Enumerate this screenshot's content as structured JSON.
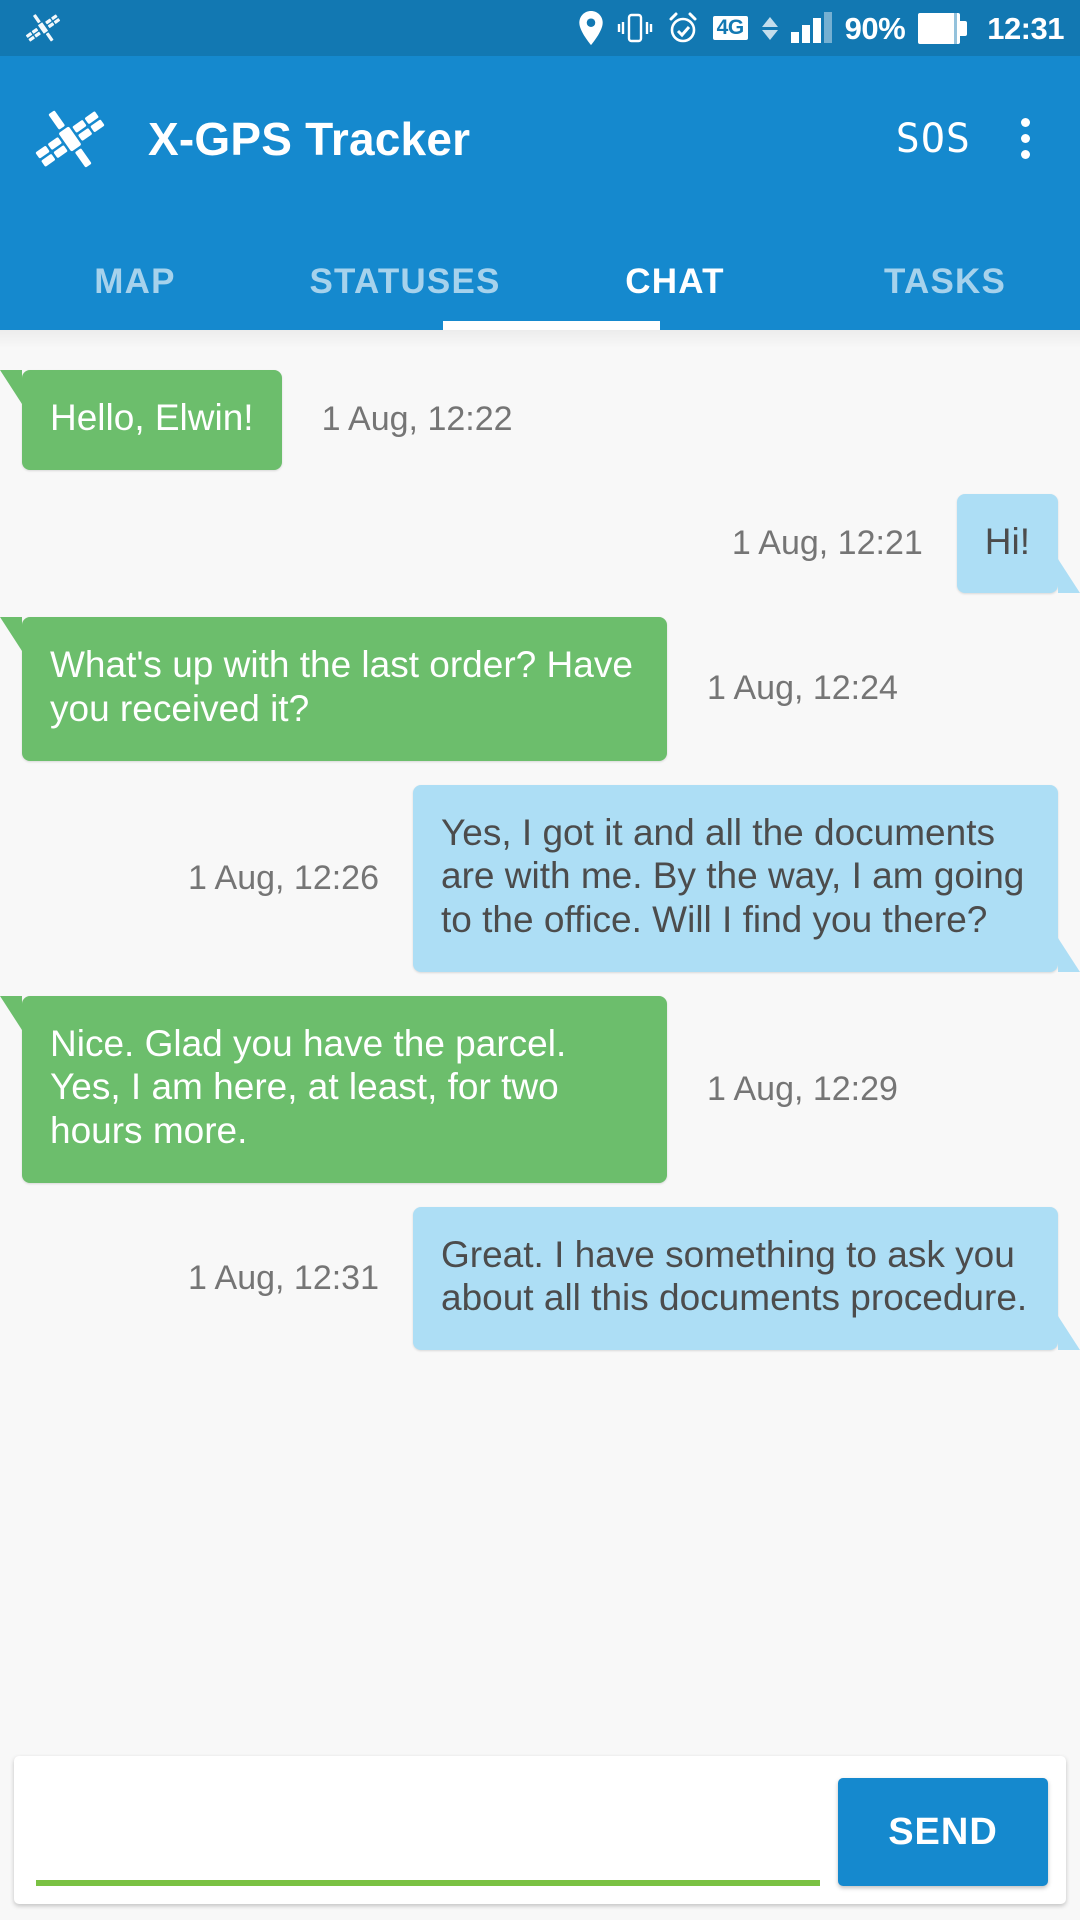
{
  "status_bar": {
    "notification_icon": "satellite-icon",
    "icons": [
      "location-pin-icon",
      "vibrate-icon",
      "alarm-clock-icon"
    ],
    "network_type": "4G",
    "data_arrows": "data-transfer-icon",
    "signal_bars": {
      "total": 4,
      "filled": 3
    },
    "battery_percent": "90%",
    "battery_icon": "battery-icon",
    "time": "12:31"
  },
  "app_bar": {
    "logo": "satellite-icon",
    "title": "X-GPS Tracker",
    "sos_label": "SOS",
    "overflow_icon": "more-vertical-icon"
  },
  "tabs": {
    "active_index": 2,
    "items": [
      {
        "label": "MAP"
      },
      {
        "label": "STATUSES"
      },
      {
        "label": "CHAT"
      },
      {
        "label": "TASKS"
      }
    ]
  },
  "chat": {
    "messages": [
      {
        "direction": "out",
        "text": "Hello, Elwin!",
        "time": "1 Aug, 12:22"
      },
      {
        "direction": "in",
        "text": "Hi!",
        "time": "1 Aug, 12:21"
      },
      {
        "direction": "out",
        "text": "What's up with the last order? Have you received it?",
        "time": "1 Aug, 12:24"
      },
      {
        "direction": "in",
        "text": "Yes, I got it and all the documents are with me. By the way, I am going to the office. Will I find you there?",
        "time": "1 Aug, 12:26"
      },
      {
        "direction": "out",
        "text": "Nice. Glad you have the parcel. Yes, I am here, at least, for two hours more.",
        "time": "1 Aug, 12:29"
      },
      {
        "direction": "in",
        "text": "Great. I have something to ask you about all this documents procedure.",
        "time": "1 Aug, 12:31"
      }
    ]
  },
  "composer": {
    "input_value": "",
    "input_placeholder": "",
    "send_label": "SEND"
  },
  "colors": {
    "status_bar": "#1278b2",
    "app_bar": "#1589ce",
    "outgoing_bubble": "#6cbe6c",
    "incoming_bubble": "#addef5",
    "accent_underline": "#7ac143",
    "timestamp_text": "#757575"
  }
}
